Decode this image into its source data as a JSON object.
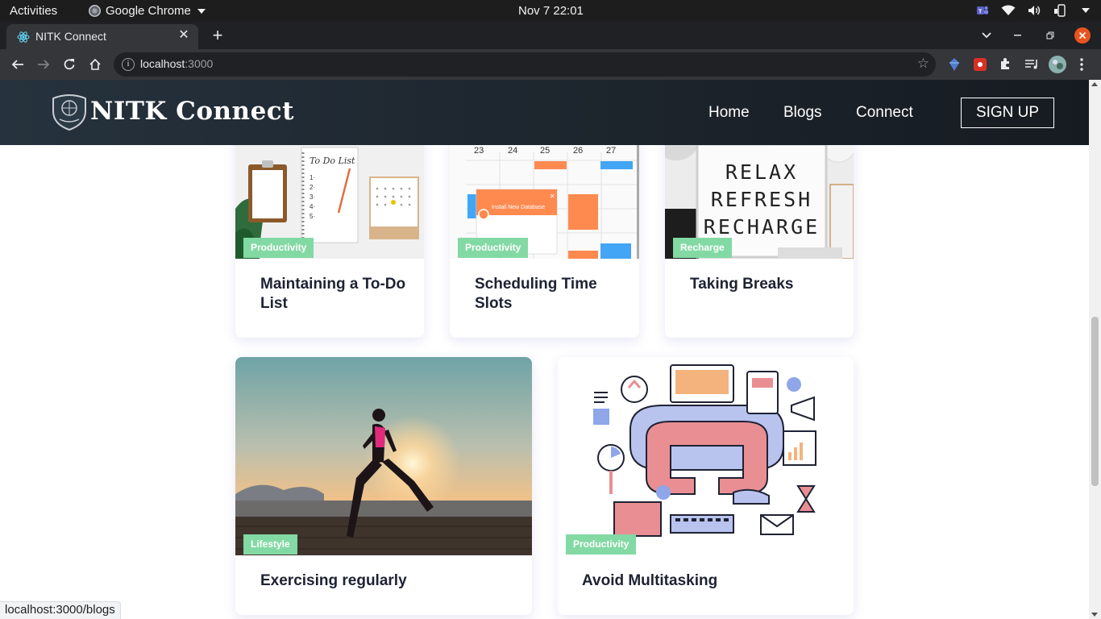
{
  "system": {
    "activities": "Activities",
    "app_name": "Google Chrome",
    "clock": "Nov 7  22:01"
  },
  "browser": {
    "tab_title": "NITK Connect",
    "url_host": "localhost",
    "url_port": ":3000",
    "status_url": "localhost:3000/blogs"
  },
  "site": {
    "brand": "NITK Connect",
    "nav": [
      "Home",
      "Blogs",
      "Connect"
    ],
    "signup": "SIGN UP"
  },
  "cards": [
    {
      "tag": "Productivity",
      "title": "Maintaining a To-Do List",
      "image": "todo-list-photo"
    },
    {
      "tag": "Productivity",
      "title": "Scheduling Time Slots",
      "image": "calendar-screenshot"
    },
    {
      "tag": "Recharge",
      "title": "Taking Breaks",
      "image": "relax-refresh-recharge-lightbox",
      "image_text": [
        "RELAX",
        "REFRESH",
        "RECHARGE"
      ]
    },
    {
      "tag": "Lifestyle",
      "title": "Exercising regularly",
      "image": "runner-at-sunset"
    },
    {
      "tag": "Productivity",
      "title": "Avoid Multitasking",
      "image": "multitasking-illustration"
    }
  ],
  "calendar_days": [
    "23",
    "24",
    "25",
    "26",
    "27"
  ],
  "calendar_popup": "Install New Database",
  "colors": {
    "tag_bg": "#83d9a4",
    "nav_bg": "#1f2831",
    "title_text": "#1d2233"
  }
}
